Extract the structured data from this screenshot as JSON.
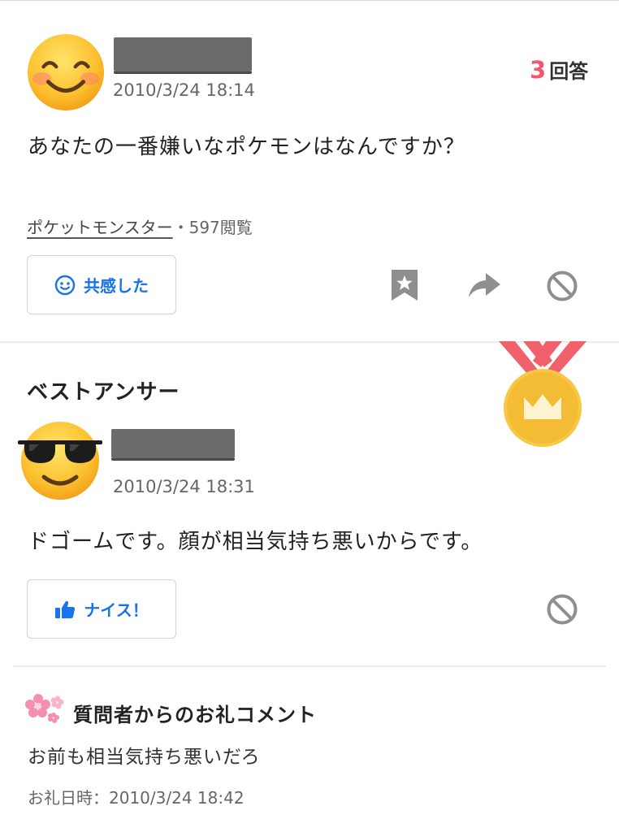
{
  "question": {
    "date": "2010/3/24 18:14",
    "answer_count": "3",
    "answer_count_label": "回答",
    "text": "あなたの一番嫌いなポケモンはなんですか？",
    "category": "ポケットモンスター",
    "views": "・597閲覧",
    "empathize_label": "共感した",
    "avatar_icon": "smiling-face-emoji",
    "colors": {
      "accent": "#1a73e8",
      "count": "#f2576b"
    }
  },
  "best_answer": {
    "heading": "ベストアンサー",
    "date": "2010/3/24 18:31",
    "text": "ドゴームです。顔が相当気持ち悪いからです。",
    "nice_label": "ナイス！",
    "avatar_icon": "sunglasses-face-emoji",
    "medal_icon": "gold-crown-medal"
  },
  "thanks": {
    "title": "質問者からのお礼コメント",
    "text": "お前も相当気持ち悪いだろ",
    "date": "お礼日時：2010/3/24 18:42",
    "icon": "cherry-blossom-icon"
  }
}
